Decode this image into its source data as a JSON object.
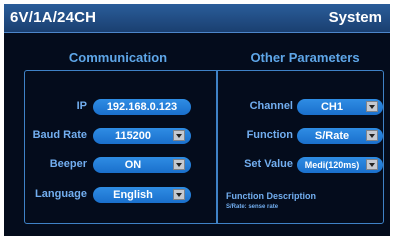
{
  "header": {
    "title": "6V/1A/24CH",
    "menu": "System"
  },
  "communication": {
    "title": "Communication",
    "ip": {
      "label": "IP",
      "value": "192.168.0.123"
    },
    "baud_rate": {
      "label": "Baud Rate",
      "value": "115200"
    },
    "beeper": {
      "label": "Beeper",
      "value": "ON"
    },
    "language": {
      "label": "Language",
      "value": "English"
    }
  },
  "other": {
    "title": "Other Parameters",
    "channel": {
      "label": "Channel",
      "value": "CH1"
    },
    "function": {
      "label": "Function",
      "value": "S/Rate"
    },
    "set_value": {
      "label": "Set Value",
      "value": "Medi(120ms)"
    },
    "description_title": "Function Description",
    "description_text": "S/Rate: sense rate"
  },
  "icons": [
    "dropdown-arrow-icon"
  ],
  "colors": {
    "background": "#040c1c",
    "title_bar": "#1f4a80",
    "accent": "#3f82c6",
    "label": "#72aef0",
    "pill": "#1a6fcc"
  }
}
